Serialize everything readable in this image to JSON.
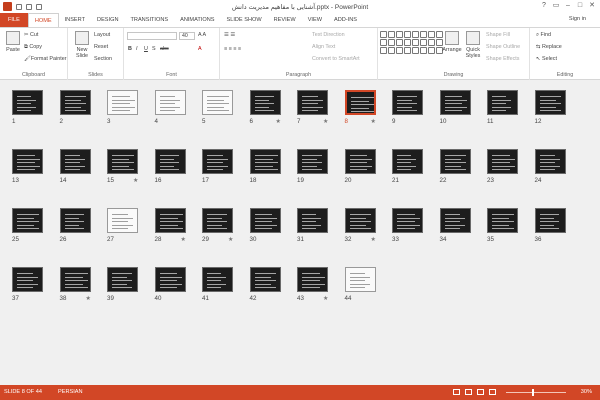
{
  "window": {
    "title": "آشنایی با مفاهیم مدیریت دانش.pptx - PowerPoint",
    "controls": [
      "?",
      "▭",
      "–",
      "□",
      "✕"
    ]
  },
  "tabs": [
    "FILE",
    "HOME",
    "INSERT",
    "DESIGN",
    "TRANSITIONS",
    "ANIMATIONS",
    "SLIDE SHOW",
    "REVIEW",
    "VIEW",
    "ADD-INS"
  ],
  "active_tab": "HOME",
  "account": {
    "sign_in": "Sign in"
  },
  "ribbon": {
    "clipboard": {
      "label": "Clipboard",
      "paste": "Paste",
      "cut": "Cut",
      "copy": "Copy",
      "format_painter": "Format Painter"
    },
    "slides": {
      "label": "Slides",
      "new_slide": "New Slide",
      "layout": "Layout",
      "reset": "Reset",
      "section": "Section"
    },
    "font": {
      "label": "Font",
      "size": "40"
    },
    "paragraph": {
      "label": "Paragraph",
      "text_direction": "Text Direction",
      "align_text": "Align Text",
      "convert_smartart": "Convert to SmartArt"
    },
    "drawing": {
      "label": "Drawing",
      "arrange": "Arrange",
      "quick_styles": "Quick Styles",
      "shape_fill": "Shape Fill",
      "shape_outline": "Shape Outline",
      "shape_effects": "Shape Effects"
    },
    "editing": {
      "label": "Editing",
      "find": "Find",
      "replace": "Replace",
      "select": "Select"
    }
  },
  "slides": [
    {
      "n": "1",
      "style": "dark",
      "star": ""
    },
    {
      "n": "2",
      "style": "dark",
      "star": ""
    },
    {
      "n": "3",
      "style": "light",
      "star": ""
    },
    {
      "n": "4",
      "style": "light",
      "star": ""
    },
    {
      "n": "5",
      "style": "light",
      "star": ""
    },
    {
      "n": "6",
      "style": "dark",
      "star": "★"
    },
    {
      "n": "7",
      "style": "dark",
      "star": "★"
    },
    {
      "n": "8",
      "style": "dark",
      "star": "★"
    },
    {
      "n": "9",
      "style": "dark",
      "star": ""
    },
    {
      "n": "10",
      "style": "dark",
      "star": ""
    },
    {
      "n": "11",
      "style": "dark",
      "star": ""
    },
    {
      "n": "12",
      "style": "dark",
      "star": ""
    },
    {
      "n": "13",
      "style": "dark",
      "star": ""
    },
    {
      "n": "14",
      "style": "dark",
      "star": ""
    },
    {
      "n": "15",
      "style": "dark",
      "star": "★"
    },
    {
      "n": "16",
      "style": "dark",
      "star": ""
    },
    {
      "n": "17",
      "style": "dark",
      "star": ""
    },
    {
      "n": "18",
      "style": "dark",
      "star": ""
    },
    {
      "n": "19",
      "style": "dark",
      "star": ""
    },
    {
      "n": "20",
      "style": "dark",
      "star": ""
    },
    {
      "n": "21",
      "style": "dark",
      "star": ""
    },
    {
      "n": "22",
      "style": "dark",
      "star": ""
    },
    {
      "n": "23",
      "style": "dark",
      "star": ""
    },
    {
      "n": "24",
      "style": "dark",
      "star": ""
    },
    {
      "n": "25",
      "style": "dark",
      "star": ""
    },
    {
      "n": "26",
      "style": "dark",
      "star": ""
    },
    {
      "n": "27",
      "style": "light",
      "star": ""
    },
    {
      "n": "28",
      "style": "dark",
      "star": "★"
    },
    {
      "n": "29",
      "style": "dark",
      "star": "★"
    },
    {
      "n": "30",
      "style": "dark",
      "star": ""
    },
    {
      "n": "31",
      "style": "dark",
      "star": ""
    },
    {
      "n": "32",
      "style": "dark",
      "star": "★"
    },
    {
      "n": "33",
      "style": "dark",
      "star": ""
    },
    {
      "n": "34",
      "style": "dark",
      "star": ""
    },
    {
      "n": "35",
      "style": "dark",
      "star": ""
    },
    {
      "n": "36",
      "style": "dark",
      "star": ""
    },
    {
      "n": "37",
      "style": "dark",
      "star": ""
    },
    {
      "n": "38",
      "style": "dark",
      "star": "★"
    },
    {
      "n": "39",
      "style": "dark",
      "star": ""
    },
    {
      "n": "40",
      "style": "dark",
      "star": ""
    },
    {
      "n": "41",
      "style": "dark",
      "star": ""
    },
    {
      "n": "42",
      "style": "dark",
      "star": ""
    },
    {
      "n": "43",
      "style": "dark",
      "star": "★"
    },
    {
      "n": "44",
      "style": "light",
      "star": ""
    }
  ],
  "selected_slide": "8",
  "status": {
    "slide_count": "SLIDE 8 OF 44",
    "language": "PERSIAN",
    "zoom": "30%"
  },
  "colors": {
    "accent": "#d24726",
    "selected_border": "#d24726"
  }
}
